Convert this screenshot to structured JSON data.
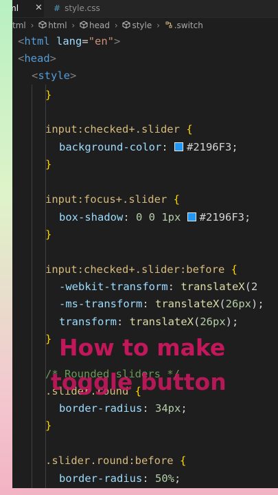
{
  "tabs": {
    "active_label": "ml",
    "active_close": "✕",
    "css_hash": "#",
    "css_label": "style.css"
  },
  "breadcrumb": {
    "file": "tml",
    "html": "html",
    "head": "head",
    "style": "style",
    "switch": ".switch"
  },
  "code": {
    "l1_tag": "html",
    "l1_attr": "lang",
    "l1_val": "\"en\"",
    "l2_tag": "head",
    "l3_tag": "style",
    "l4": "}",
    "l5_sel": "input:checked+.slider",
    "l5_brace": "{",
    "l6_prop": "background-color",
    "l6_val": "#2196F3",
    "l7": "}",
    "l8_sel": "input:focus+.slider",
    "l8_brace": "{",
    "l9_prop": "box-shadow",
    "l9_nums": "0 0 1px",
    "l9_val": "#2196F3;",
    "l10": "}",
    "l11_sel": "input:checked+.slider:before",
    "l11_brace": "{",
    "l12_prop": "-webkit-transform",
    "l12_fn": "translateX",
    "l12_tail": "(2",
    "l13_prop": "-ms-transform",
    "l13_fn": "translateX",
    "l13_arg": "26px",
    "l13_tail": ");",
    "l14_prop": "transform",
    "l14_fn": "translateX",
    "l14_arg": "26px",
    "l14_tail": ");",
    "l15": "}",
    "l16_comment": "/* Rounded sliders */",
    "l17_sel": ".slider.round",
    "l17_brace": "{",
    "l18_prop": "border-radius",
    "l18_val": "34px",
    "l19": "}",
    "l20_sel": ".slider.round:before",
    "l20_brace": "{",
    "l21_prop": "border-radius",
    "l21_val": "50%"
  },
  "overlay": {
    "line1": "How to make",
    "line2": "toggle button"
  },
  "colors": {
    "accent_swatch": "#2196F3",
    "overlay_text": "#c2185b"
  }
}
